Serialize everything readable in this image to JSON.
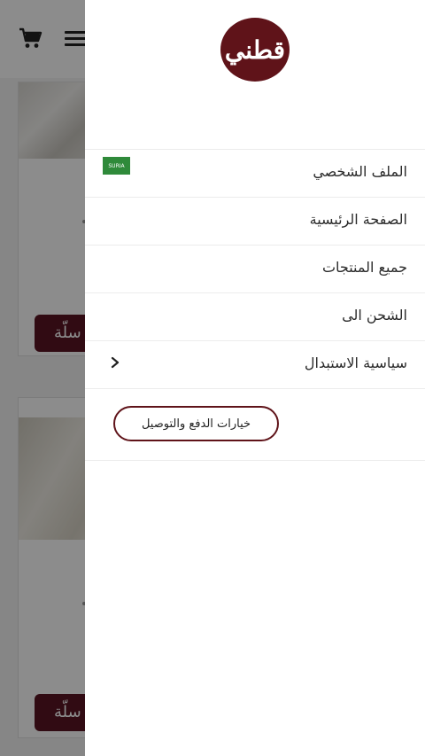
{
  "background": {
    "cart_icon": "cart-icon",
    "menu_icon": "hamburger-menu-icon",
    "cards": [
      {
        "button_label": "سلّة"
      },
      {
        "button_label": "سلّة"
      }
    ]
  },
  "drawer": {
    "logo_text": "قطني",
    "menu_items": [
      {
        "label": "الملف الشخصي"
      },
      {
        "label": "الصفحة الرئيسية"
      },
      {
        "label": "جميع المنتجات"
      },
      {
        "label": "الشحن الى",
        "flag_label": "SURIA"
      },
      {
        "label": "سياسية الاستبدال"
      }
    ],
    "payment_button": "خيارات الدفع والتوصيل"
  },
  "colors": {
    "brand": "#5f1319",
    "button_bg": "#5a1524",
    "flag_green": "#2f8a3a"
  }
}
